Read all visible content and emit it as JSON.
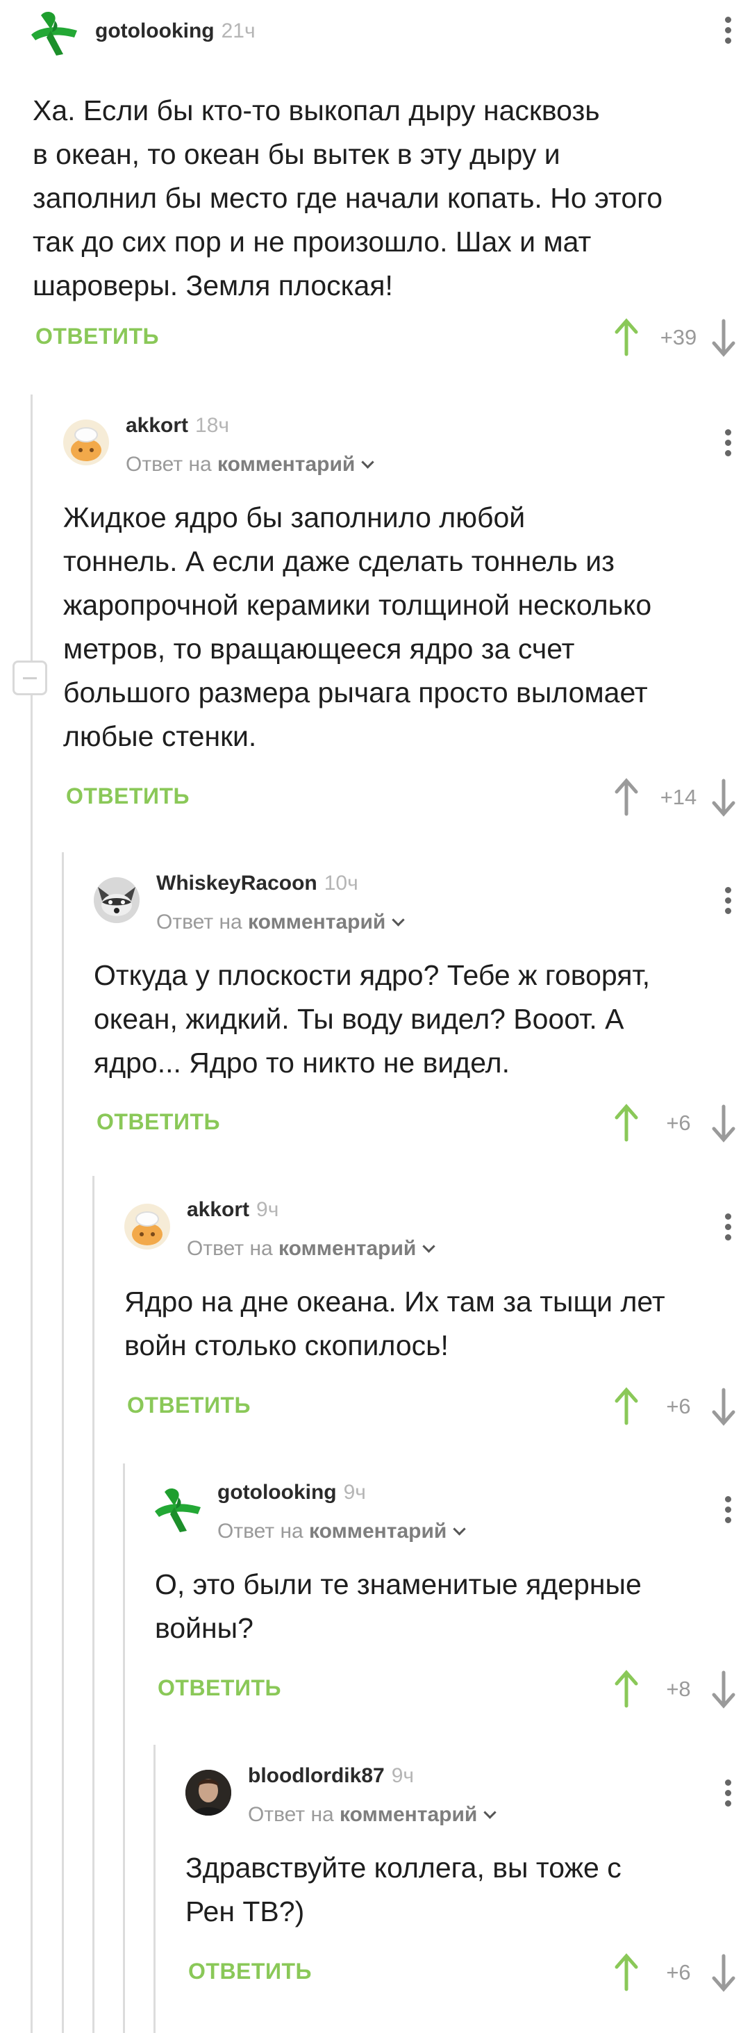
{
  "reply_label": "ОТВЕТИТЬ",
  "reply_to_prefix": "Ответ на",
  "reply_to_target": "комментарий",
  "colors": {
    "green": "#8ac858",
    "grey": "#9a9a9a",
    "line": "#dcdcdc"
  },
  "comments": [
    {
      "author": "gotolooking",
      "time": "21ч",
      "avatar": "green-ribbon",
      "text": "Ха. Если бы кто-то выкопал дыру насквозь\nв океан, то океан бы вытек в эту дыру и\nзаполнил бы место где начали копать. Но этого\nтак до сих пор и не произошло. Шах и мат\nшароверы. Земля плоская!",
      "score": "+39",
      "upvoted": true
    },
    {
      "author": "akkort",
      "time": "18ч",
      "avatar": "chef-cat",
      "text": "Жидкое ядро бы заполнило любой\nтоннель. А если даже сделать тоннель из\nжаропрочной керамики толщиной несколько\nметров, то вращающееся ядро за счет\nбольшого размера рычага просто выломает\nлюбые стенки.",
      "score": "+14",
      "upvoted": false
    },
    {
      "author": "WhiskeyRacoon",
      "time": "10ч",
      "avatar": "raccoon",
      "text": "Откуда у плоскости ядро? Тебе ж говорят,\nокеан, жидкий. Ты воду видел? Вооот. А\nядро... Ядро то никто не видел.",
      "score": "+6",
      "upvoted": true
    },
    {
      "author": "akkort",
      "time": "9ч",
      "avatar": "chef-cat",
      "text": "Ядро на дне океана. Их там за тыщи лет\nвойн столько скопилось!",
      "score": "+6",
      "upvoted": true
    },
    {
      "author": "gotolooking",
      "time": "9ч",
      "avatar": "green-ribbon",
      "text": "О, это были те знаменитые ядерные\nвойны?",
      "score": "+8",
      "upvoted": true
    },
    {
      "author": "bloodlordik87",
      "time": "9ч",
      "avatar": "person-photo",
      "text": "Здравствуйте коллега, вы тоже с\nРен ТВ?)",
      "score": "+6",
      "upvoted": true
    }
  ]
}
